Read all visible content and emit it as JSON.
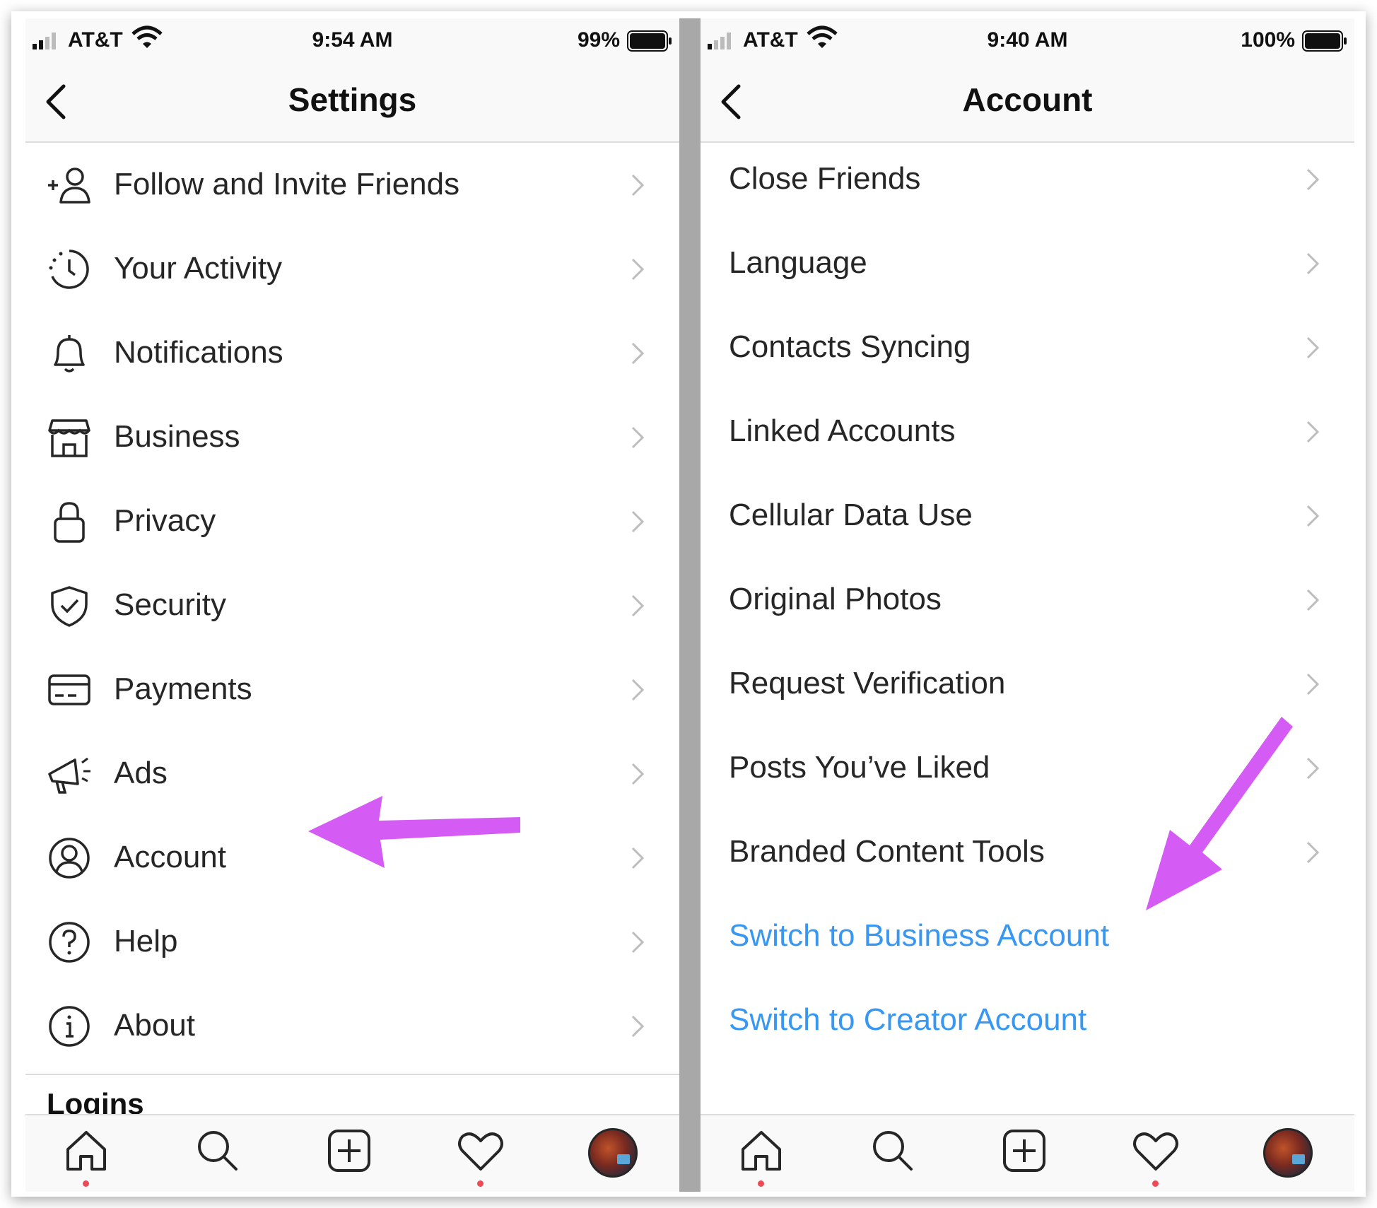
{
  "left": {
    "status": {
      "carrier": "AT&T",
      "time": "9:54 AM",
      "battery": "99%"
    },
    "nav": {
      "title": "Settings"
    },
    "items": [
      {
        "icon": "add-person-icon",
        "label": "Follow and Invite Friends"
      },
      {
        "icon": "activity-icon",
        "label": "Your Activity"
      },
      {
        "icon": "bell-icon",
        "label": "Notifications"
      },
      {
        "icon": "shop-icon",
        "label": "Business"
      },
      {
        "icon": "lock-icon",
        "label": "Privacy"
      },
      {
        "icon": "shield-icon",
        "label": "Security"
      },
      {
        "icon": "card-icon",
        "label": "Payments"
      },
      {
        "icon": "megaphone-icon",
        "label": "Ads"
      },
      {
        "icon": "person-circle-icon",
        "label": "Account"
      },
      {
        "icon": "help-icon",
        "label": "Help"
      },
      {
        "icon": "info-icon",
        "label": "About"
      }
    ],
    "section_heading": "Logins"
  },
  "right": {
    "status": {
      "carrier": "AT&T",
      "time": "9:40 AM",
      "battery": "100%"
    },
    "nav": {
      "title": "Account"
    },
    "items": [
      {
        "label": "Close Friends"
      },
      {
        "label": "Language"
      },
      {
        "label": "Contacts Syncing"
      },
      {
        "label": "Linked Accounts"
      },
      {
        "label": "Cellular Data Use"
      },
      {
        "label": "Original Photos"
      },
      {
        "label": "Request Verification"
      },
      {
        "label": "Posts You’ve Liked"
      },
      {
        "label": "Branded Content Tools"
      }
    ],
    "links": [
      {
        "label": "Switch to Business Account"
      },
      {
        "label": "Switch to Creator Account"
      }
    ]
  },
  "tabbar": {
    "icons": [
      "home-icon",
      "search-icon",
      "new-post-icon",
      "activity-heart-icon",
      "profile-avatar"
    ]
  },
  "colors": {
    "link": "#3897f0",
    "annotation_arrow": "#d45cf5",
    "notification_dot": "#ed4956"
  }
}
